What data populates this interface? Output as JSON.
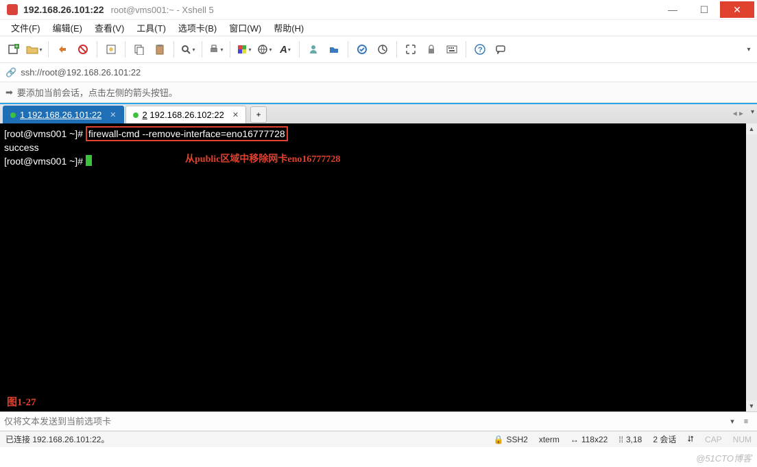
{
  "window": {
    "title_ip": "192.168.26.101:22",
    "title_sub": "root@vms001:~ - Xshell 5"
  },
  "menu": {
    "file": "文件(F)",
    "edit": "编辑(E)",
    "view": "查看(V)",
    "tools": "工具(T)",
    "tabs": "选项卡(B)",
    "window": "窗口(W)",
    "help": "帮助(H)"
  },
  "address": {
    "url": "ssh://root@192.168.26.101:22"
  },
  "infobar": {
    "hint": "要添加当前会话，点击左侧的箭头按钮。"
  },
  "tabs": {
    "active": {
      "num": "1",
      "label": "192.168.26.101:22"
    },
    "other": {
      "num": "2",
      "label": "192.168.26.102:22"
    }
  },
  "terminal": {
    "prompt1": "[root@vms001 ~]# ",
    "command": "firewall-cmd --remove-interface=eno16777728",
    "output": "success",
    "prompt2": "[root@vms001 ~]# ",
    "annotation": "从public区域中移除网卡eno16777728",
    "figure_label": "图1-27"
  },
  "inputbar": {
    "placeholder": "仅将文本发送到当前选项卡"
  },
  "status": {
    "connected": "已连接 192.168.26.101:22。",
    "ssh": "SSH2",
    "term": "xterm",
    "size": "118x22",
    "pos": "3,18",
    "sessions": "2 会话",
    "cap": "CAP",
    "num": "NUM"
  },
  "watermark": "@51CTO博客"
}
